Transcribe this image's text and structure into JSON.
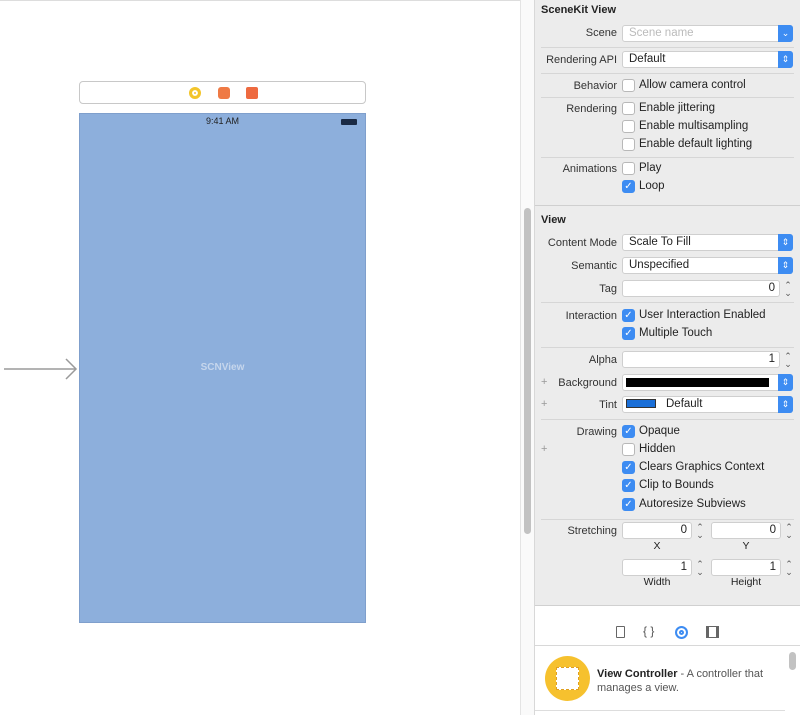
{
  "canvas": {
    "status_time": "9:41 AM",
    "view_label": "SCNView",
    "scene_bar_icons": [
      "view-controller-icon",
      "first-responder-icon",
      "exit-icon"
    ]
  },
  "scenekit": {
    "title": "SceneKit View",
    "scene_label": "Scene",
    "scene_placeholder": "Scene name",
    "scene_value": "",
    "rendering_api_label": "Rendering API",
    "rendering_api_value": "Default",
    "behavior_label": "Behavior",
    "allow_camera": {
      "label": "Allow camera control",
      "checked": false
    },
    "rendering_label": "Rendering",
    "jittering": {
      "label": "Enable jittering",
      "checked": false
    },
    "multisampling": {
      "label": "Enable multisampling",
      "checked": false
    },
    "default_lighting": {
      "label": "Enable default lighting",
      "checked": false
    },
    "animations_label": "Animations",
    "play": {
      "label": "Play",
      "checked": false
    },
    "loop": {
      "label": "Loop",
      "checked": true
    }
  },
  "view": {
    "title": "View",
    "content_mode_label": "Content Mode",
    "content_mode_value": "Scale To Fill",
    "semantic_label": "Semantic",
    "semantic_value": "Unspecified",
    "tag_label": "Tag",
    "tag_value": "0",
    "interaction_label": "Interaction",
    "user_interaction": {
      "label": "User Interaction Enabled",
      "checked": true
    },
    "multiple_touch": {
      "label": "Multiple Touch",
      "checked": true
    },
    "alpha_label": "Alpha",
    "alpha_value": "1",
    "background_label": "Background",
    "background_color": "#000000",
    "tint_label": "Tint",
    "tint_value": "Default",
    "tint_color": "#1a6fd8",
    "drawing_label": "Drawing",
    "opaque": {
      "label": "Opaque",
      "checked": true
    },
    "hidden": {
      "label": "Hidden",
      "checked": false
    },
    "clears_graphics": {
      "label": "Clears Graphics Context",
      "checked": true
    },
    "clip_bounds": {
      "label": "Clip to Bounds",
      "checked": true
    },
    "autoresize": {
      "label": "Autoresize Subviews",
      "checked": true
    },
    "stretching_label": "Stretching",
    "stretch_x": "0",
    "stretch_y": "0",
    "stretch_width": "1",
    "stretch_height": "1",
    "x_caption": "X",
    "y_caption": "Y",
    "width_caption": "Width",
    "height_caption": "Height"
  },
  "library_tabs": [
    "file-template-icon",
    "code-snippet-icon",
    "object-library-icon",
    "media-library-icon"
  ],
  "library": {
    "item_title": "View Controller",
    "item_desc": " - A controller that manages a view."
  },
  "colors": {
    "accent": "#3d8cf2",
    "view_bg": "#8dafdc",
    "library_icon": "#f6c12e"
  }
}
